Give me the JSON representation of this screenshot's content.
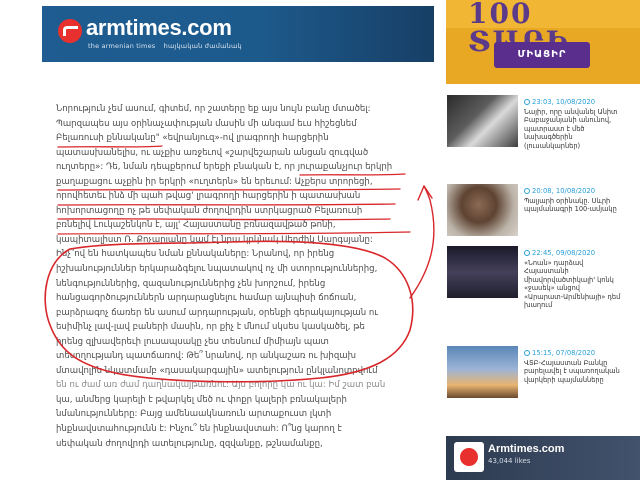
{
  "header": {
    "logo_text": "armtimes.com",
    "logo_subtitle_en": "the armenian times",
    "logo_subtitle_hy": "հայկական ժամանակ"
  },
  "ad": {
    "headline": "100 ՏԱՐԻ",
    "button_label": "ՄԻԱՑԻՐ"
  },
  "article": {
    "lines": [
      "Նորություն չեմ ասում, գիտեմ, որ շատերը եք այս նույն բանը մտածել:",
      "Պարզապես այս օրինաչափության մասին մի անգամ եւս հիշեցնեմ",
      "Բելառուսի քննականը\" «եվրանյուզ»-ով լրագրողի հարցերին",
      "պատասխանելիս, ու աչքիս առջեւով «շարվեշարան անցան զուգված",
      "ուղտերը»: Դե, նման դեպքերում երեքի բնական է, որ յուրաքանչյուր երկրի",
      "քաղաքացու աչքին իր երկրի «ուղտերն» են երեւում: Աչքերս տրորեցի,",
      "որովհետեւ ինձ մի պահ թվաց' լրագրողի հարցերին ի պատասխան",
      "հոխորտացողը ոչ թե սեփական ժողովրդին ստրկացրած Բելառուսի",
      "բռնելիվ Լուկաշենկոն է, այլ' Հայաստանը բռնազավթած թոնի,",
      "կապիտալիստ Ռ. Քոչարյանը կամ էլ նրա կրկնակ Սերժիկ Սարգսյանը:",
      "Ինչ՞ով են հատկապես նման քննակաները: Նրանով, որ իրենց",
      "իշխանություններ երկարաձգելու նպատակով ոչ մի ստորություններից,",
      "նենգություններից, զազանություններից չեն խորշում, իրենց",
      "հանցագործություններն արդարացնելու համար այնպիսի ճոճոան,",
      "բարձրագոչ ճառեր են ասում արդարության, օրենքի գերակայության ու",
      "եսիմինչ լավ-լավ բաների մասին, որ քիչ է մնում սկսես կասկածել, թե",
      "իրենց զլխավերեւի լուսապսակը չես տեսնում միմիայն պատ",
      "տեսողությանդ պատճառով: Թե՞ նրանով, որ անկաշառ ու խիզախ",
      "մտավոլին նկատմամբ «դասակարգային» ատելություն ընկլանոտրվում",
      "են ու ժամ առ ժամ դաղնակայթառնու: Այս բոլորը կա ու կա: Իմ շատ բան",
      "կա, անմերց կարելի է թվարկել մեծ ու փոքր կալերի բռնակալերի",
      "նմանությունները: Բայց ամենաակնառուն արտաքուստ լկտի",
      "ինքնավստահությունն է: Ինչու՞ են ինքնավստահ: Ո՞նց կարող է",
      "սեփական ժողովրդի ատելությունը, զզվանքը, թշնամանքը,"
    ]
  },
  "news": [
    {
      "time": "23:03, 10/08/2020",
      "title_lines": [
        "Նայիր, որը անվանել Անիտ",
        "Բաբաջանյանի անունով,",
        "պատրաստ է մեծ",
        "նախագծերին",
        "(լուսանկարներ)"
      ]
    },
    {
      "time": "20:08, 10/08/2020",
      "title_lines": [
        "Պալյարի օրինակը. Սևրի",
        "պայմանագրի 100-ամյակը"
      ]
    },
    {
      "time": "22:45, 09/08/2020",
      "title_lines": [
        "«Նոան» դարձավ",
        "Հայաստանի",
        "միավորվածտիկալի' կոնկ",
        "«ջասեկ» անցով",
        "«Արարատ-Արմենիայի» դեմ",
        "խաղում"
      ]
    },
    {
      "time": "15:15, 07/08/2020",
      "title_lines": [
        "ՎՏԲ-Հայաստան Բանկը",
        "բարելավել է սպառողական",
        "վարկերի պայմանները"
      ]
    }
  ],
  "facebook": {
    "page_name": "Armtimes.com",
    "likes": "43,044 likes"
  },
  "colors": {
    "banner": "#1e5c91",
    "brand_red": "#e8302f",
    "annotation_red": "#d8262a",
    "news_time": "#29a0d8"
  }
}
